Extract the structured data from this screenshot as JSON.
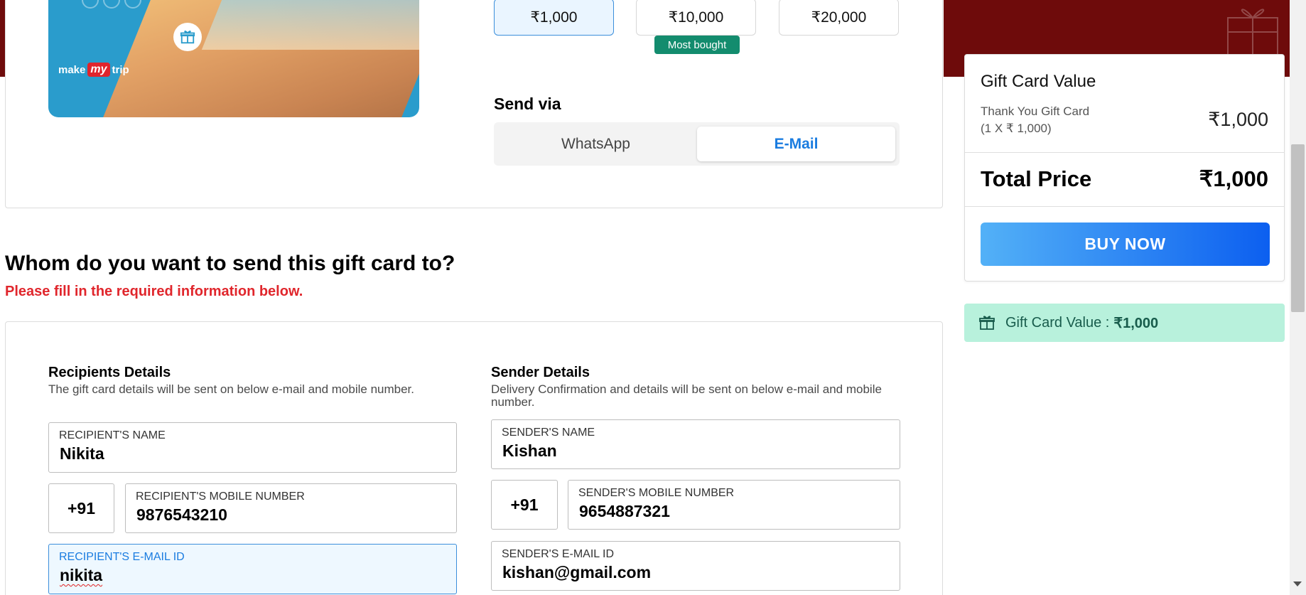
{
  "hero": {
    "logo_make": "make",
    "logo_my": "my",
    "logo_trip": "trip"
  },
  "denominations": {
    "d1": "₹1,000",
    "d2": "₹10,000",
    "d3": "₹20,000",
    "badge": "Most bought"
  },
  "send_via": {
    "label": "Send via",
    "whatsapp": "WhatsApp",
    "email": "E-Mail"
  },
  "form": {
    "heading": "Whom do you want to send this gift card to?",
    "required": "Please fill in the required information below.",
    "recipient": {
      "title": "Recipients Details",
      "subtitle": "The gift card details will be sent on below e-mail and mobile number.",
      "name_label": "RECIPIENT'S NAME",
      "name_value": "Nikita",
      "country_code": "+91",
      "mobile_label": "RECIPIENT'S MOBILE NUMBER",
      "mobile_value": "9876543210",
      "email_label": "RECIPIENT'S E-MAIL ID",
      "email_value": "nikita"
    },
    "sender": {
      "title": "Sender Details",
      "subtitle_1": "Delivery Confirmation and details will be sent on below e-mail and mobile",
      "subtitle_2": "number.",
      "name_label": "SENDER'S NAME",
      "name_value": "Kishan",
      "country_code": "+91",
      "mobile_label": "SENDER'S MOBILE NUMBER",
      "mobile_value": "9654887321",
      "email_label": "SENDER'S E-MAIL ID",
      "email_value": "kishan@gmail.com"
    }
  },
  "summary": {
    "title": "Gift Card Value",
    "item_line1": "Thank You Gift Card",
    "item_line2": "(1 X ₹ 1,000)",
    "item_value": "₹1,000",
    "total_label": "Total Price",
    "total_value": "₹1,000",
    "buy_label": "BUY NOW"
  },
  "promo": {
    "label": "Gift Card Value :",
    "value": "₹1,000"
  },
  "colors": {
    "brand_red": "#6e0b0b",
    "accent_blue": "#1a7ce0",
    "error_red": "#e0262c",
    "promo_green": "#b8f1dc"
  }
}
